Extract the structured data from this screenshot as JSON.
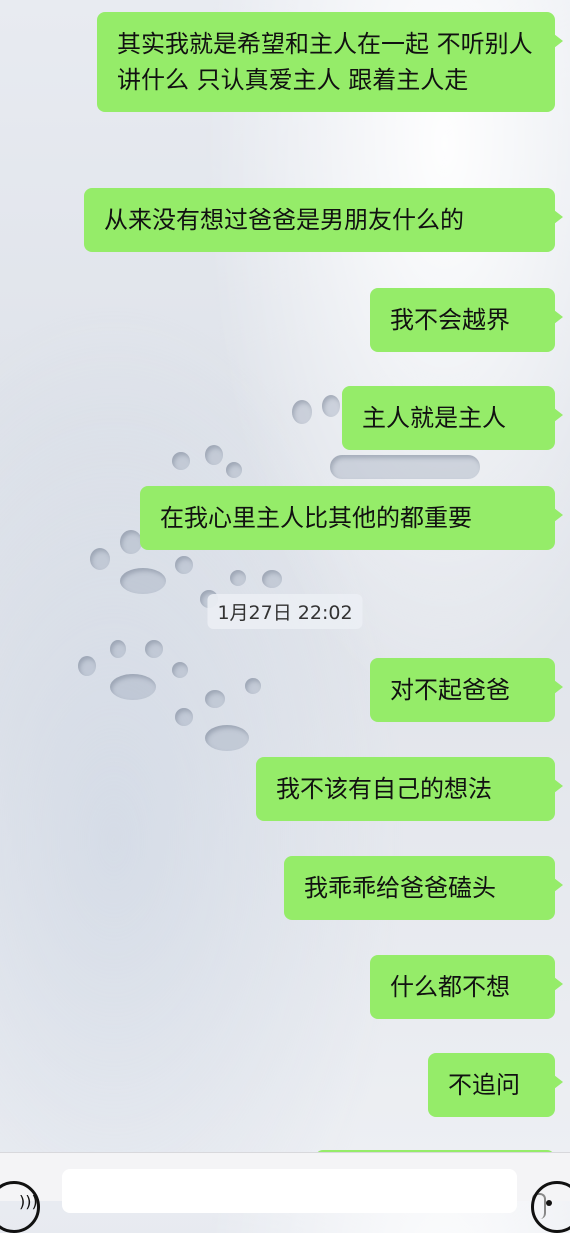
{
  "messages": [
    {
      "text": "其实我就是希望和主人在一起 不听别人讲什么 只认真爱主人 跟着主人走"
    },
    {
      "text": "从来没有想过爸爸是男朋友什么的"
    },
    {
      "text": "我不会越界"
    },
    {
      "text": "主人就是主人"
    },
    {
      "text": "在我心里主人比其他的都重要"
    },
    {
      "text": "对不起爸爸"
    },
    {
      "text": "我不该有自己的想法"
    },
    {
      "text": "我乖乖给爸爸磕头"
    },
    {
      "text": "什么都不想"
    },
    {
      "text": "不追问"
    }
  ],
  "timestamp": "1月27日 22:02",
  "colors": {
    "bubble": "#95ec69",
    "background": "#e3e6ec"
  },
  "icons": {
    "left": "voice-icon",
    "right": "emoji-icon"
  }
}
